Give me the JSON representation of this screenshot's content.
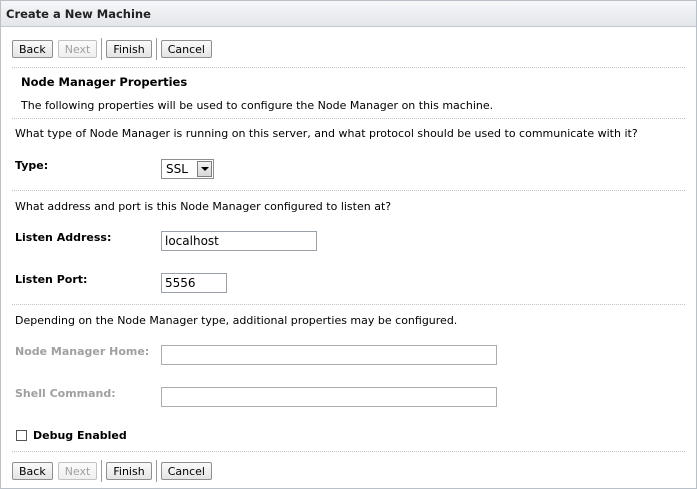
{
  "window": {
    "title": "Create a New Machine"
  },
  "toolbar": {
    "back_label": "Back",
    "next_label": "Next",
    "finish_label": "Finish",
    "cancel_label": "Cancel"
  },
  "section": {
    "title": "Node Manager Properties",
    "description": "The following properties will be used to configure the Node Manager on this machine."
  },
  "type_group": {
    "question": "What type of Node Manager is running on this server, and what protocol should be used to communicate with it?",
    "label": "Type:",
    "selected": "SSL"
  },
  "address_group": {
    "question": "What address and port is this Node Manager configured to listen at?",
    "listen_address_label": "Listen Address:",
    "listen_address_value": "localhost",
    "listen_port_label": "Listen Port:",
    "listen_port_value": "5556"
  },
  "additional_group": {
    "question": "Depending on the Node Manager type, additional properties may be configured.",
    "node_manager_home_label": "Node Manager Home:",
    "node_manager_home_value": "",
    "shell_command_label": "Shell Command:",
    "shell_command_value": ""
  },
  "debug": {
    "label": "Debug Enabled",
    "checked": false
  }
}
